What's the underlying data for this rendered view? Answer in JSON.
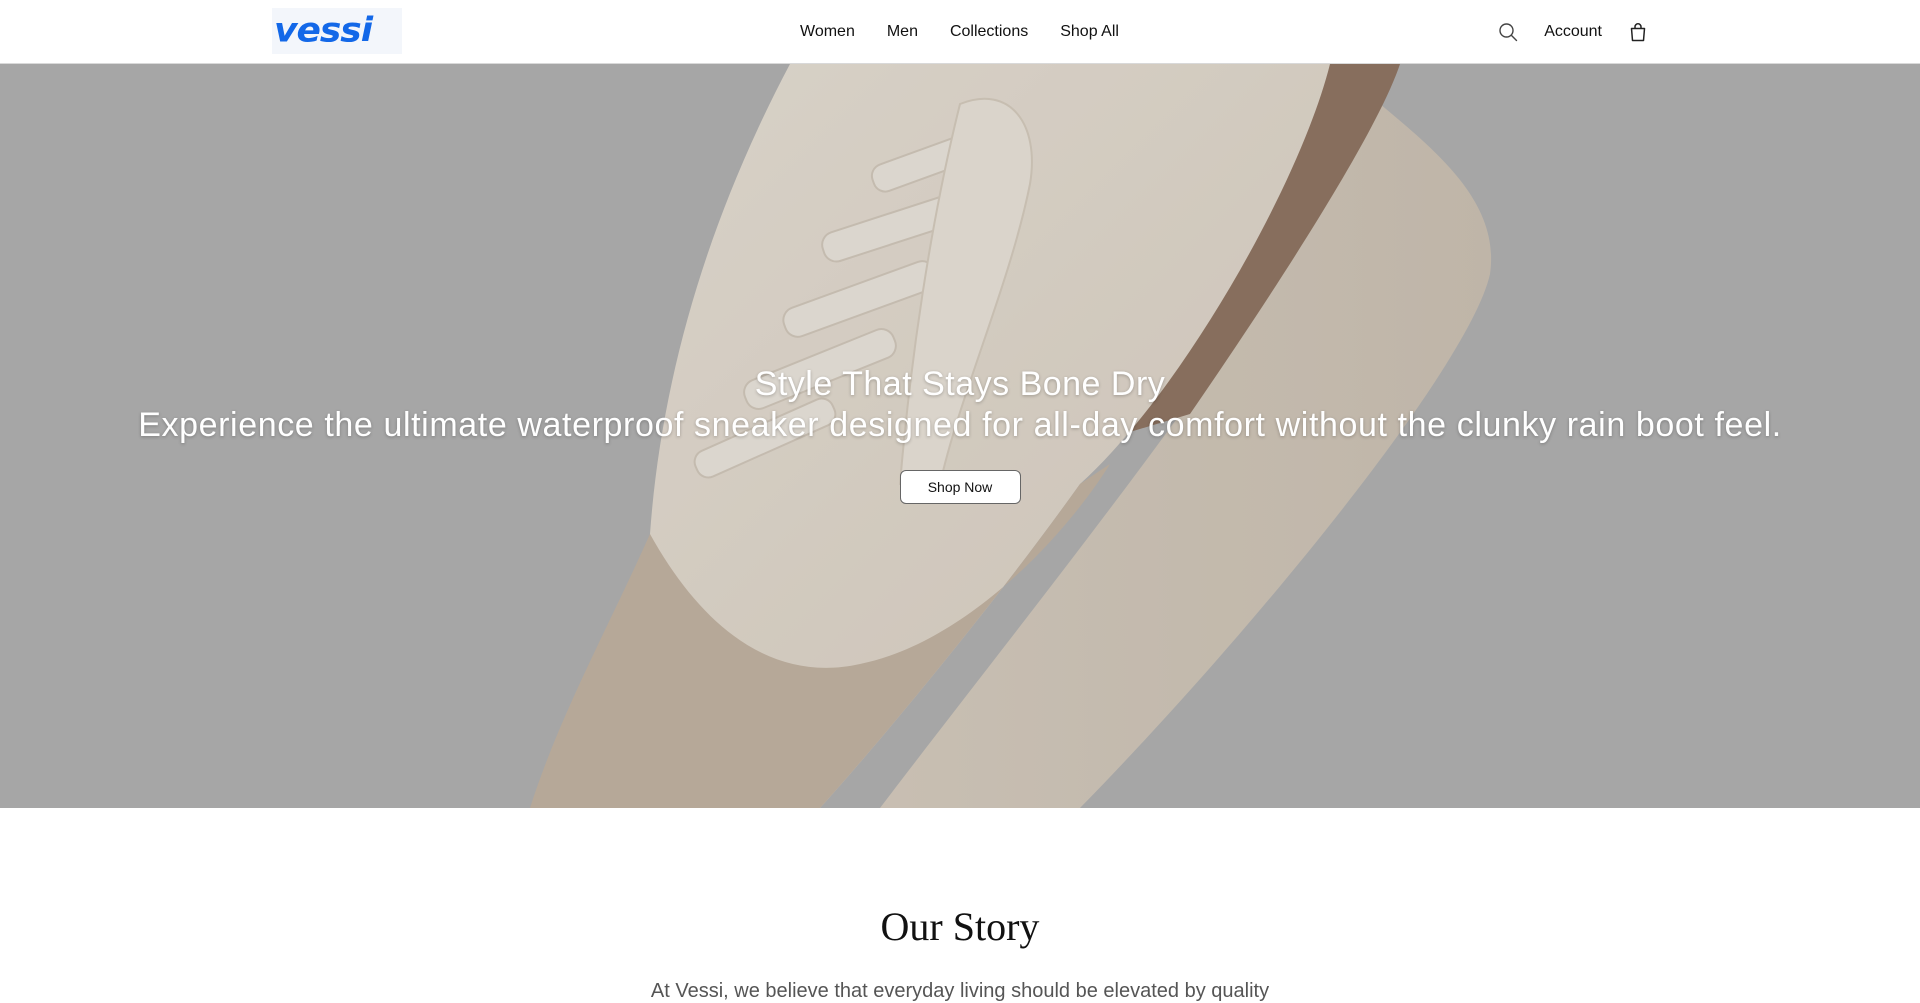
{
  "header": {
    "logo": "vessi",
    "nav": [
      "Women",
      "Men",
      "Collections",
      "Shop All"
    ],
    "account_label": "Account",
    "icons": {
      "search": "search-icon",
      "bag": "shopping-bag-icon"
    }
  },
  "hero": {
    "title": "Style That Stays Bone Dry",
    "subtitle": "Experience the ultimate waterproof sneaker designed for all-day comfort without the clunky rain boot feel.",
    "cta_label": "Shop Now"
  },
  "story": {
    "title": "Our Story",
    "text": "At Vessi, we believe that everyday living should be elevated by quality"
  },
  "colors": {
    "brand": "#1368e8",
    "hero_bg": "#b0b0b0",
    "shoe_upper": "#e6ddd0",
    "shoe_accent": "#8c6a52",
    "shoe_sole": "#dcd1c2"
  }
}
